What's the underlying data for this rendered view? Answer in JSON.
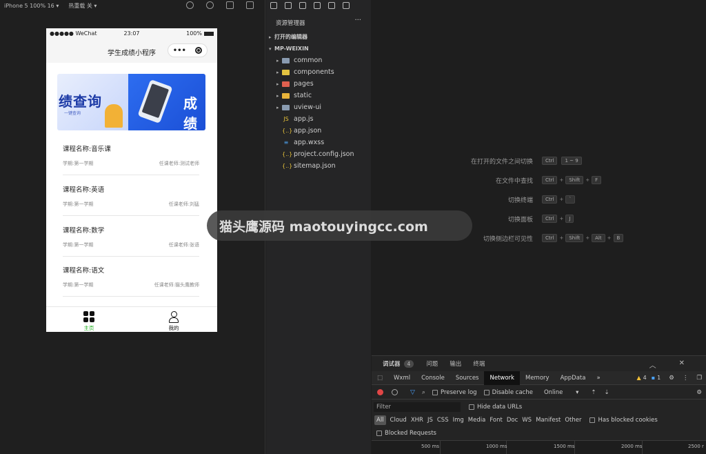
{
  "simulator": {
    "device": "iPhone 5 100% 16",
    "hotreload": "热重载 关",
    "status": {
      "carrier": "●●●●● WeChat",
      "time": "23:07",
      "battery": "100%"
    },
    "nav_title": "学生成绩小程序",
    "capsule_dots": "•••",
    "banner": {
      "left_big": "绩查询",
      "left_small": "一键查询",
      "right_big": "成绩"
    },
    "courses": [
      {
        "name": "课程名称:音乐课",
        "term": "学期:第一学期",
        "teacher": "任课老师:测试老师"
      },
      {
        "name": "课程名称:英语",
        "term": "学期:第一学期",
        "teacher": "任课老师:刘猛"
      },
      {
        "name": "课程名称:数学",
        "term": "学期:第一学期",
        "teacher": "任课老师:张语"
      },
      {
        "name": "课程名称:语文",
        "term": "学期:第一学期",
        "teacher": "任课老师:猫头鹰教师"
      }
    ],
    "tabs": [
      {
        "label": "主页",
        "color": "#1aad19"
      },
      {
        "label": "我的",
        "color": "#111111"
      }
    ]
  },
  "watermark": "猫头鹰源码 maotouyingcc.com",
  "explorer": {
    "title": "资源管理器",
    "more": "···",
    "open_editors": "打开的编辑器",
    "project": "MP-WEIXIN",
    "items": [
      {
        "label": "common",
        "kind": "folder",
        "color": "#8a9bb0"
      },
      {
        "label": "components",
        "kind": "folder",
        "color": "#e3c341"
      },
      {
        "label": "pages",
        "kind": "folder",
        "color": "#e0604f"
      },
      {
        "label": "static",
        "kind": "folder",
        "color": "#e8b33a"
      },
      {
        "label": "uview-ui",
        "kind": "folder",
        "color": "#8a9bb0"
      },
      {
        "label": "app.js",
        "kind": "js",
        "glyph": "JS",
        "color": "#e8c33a"
      },
      {
        "label": "app.json",
        "kind": "json",
        "glyph": "{..}",
        "color": "#e8c33a"
      },
      {
        "label": "app.wxss",
        "kind": "css",
        "glyph": "≡",
        "color": "#4c9ee8"
      },
      {
        "label": "project.config.json",
        "kind": "json",
        "glyph": "{..}",
        "color": "#e8c33a"
      },
      {
        "label": "sitemap.json",
        "kind": "json",
        "glyph": "{..}",
        "color": "#e8c33a"
      }
    ]
  },
  "shortcuts": [
    {
      "label": "在打开的文件之间切换",
      "keys": [
        "Ctrl",
        "1 ~ 9"
      ]
    },
    {
      "label": "在文件中查找",
      "keys": [
        "Ctrl",
        "Shift",
        "F"
      ]
    },
    {
      "label": "切换终端",
      "keys": [
        "Ctrl",
        "`"
      ]
    },
    {
      "label": "切换面板",
      "keys": [
        "Ctrl",
        "J"
      ]
    },
    {
      "label": "切换侧边栏可见性",
      "keys": [
        "Ctrl",
        "Shift",
        "Alt",
        "B"
      ]
    }
  ],
  "devtools": {
    "top_tabs": [
      "调试器",
      "问题",
      "输出",
      "终端"
    ],
    "badge": "4",
    "tabs": [
      "Wxml",
      "Console",
      "Sources",
      "Network",
      "Memory",
      "AppData"
    ],
    "active_tab": "Network",
    "more_tabs": "»",
    "warn_count": "4",
    "info_count": "1",
    "preserve_log": "Preserve log",
    "disable_cache": "Disable cache",
    "throttle": "Online",
    "filter_placeholder": "Filter",
    "hide_data_urls": "Hide data URLs",
    "types": [
      "All",
      "Cloud",
      "XHR",
      "JS",
      "CSS",
      "Img",
      "Media",
      "Font",
      "Doc",
      "WS",
      "Manifest",
      "Other"
    ],
    "has_blocked_cookies": "Has blocked cookies",
    "blocked_requests": "Blocked Requests",
    "timeline": [
      "500 ms",
      "1000 ms",
      "1500 ms",
      "2000 ms",
      "2500 r"
    ]
  }
}
